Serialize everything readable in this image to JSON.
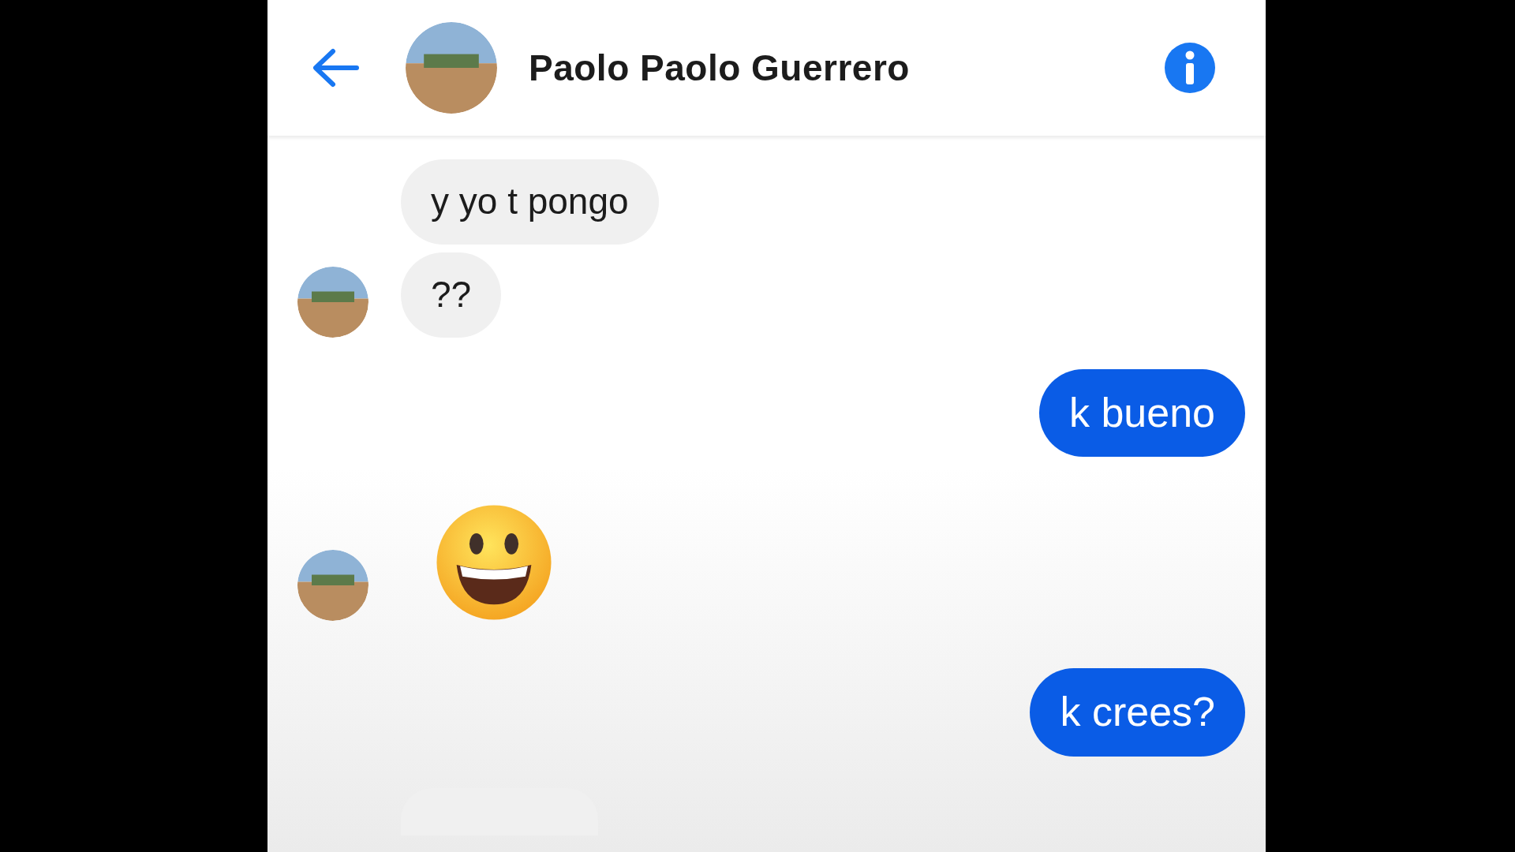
{
  "header": {
    "title": "Paolo Paolo Guerrero"
  },
  "messages": [
    {
      "kind": "received",
      "avatar": false,
      "text": "y yo t pongo"
    },
    {
      "kind": "received",
      "avatar": true,
      "text": "??"
    },
    {
      "kind": "sent",
      "text": "k bueno"
    },
    {
      "kind": "emoji",
      "avatar": true
    },
    {
      "kind": "sent",
      "text": "k crees?"
    },
    {
      "kind": "cut"
    }
  ]
}
